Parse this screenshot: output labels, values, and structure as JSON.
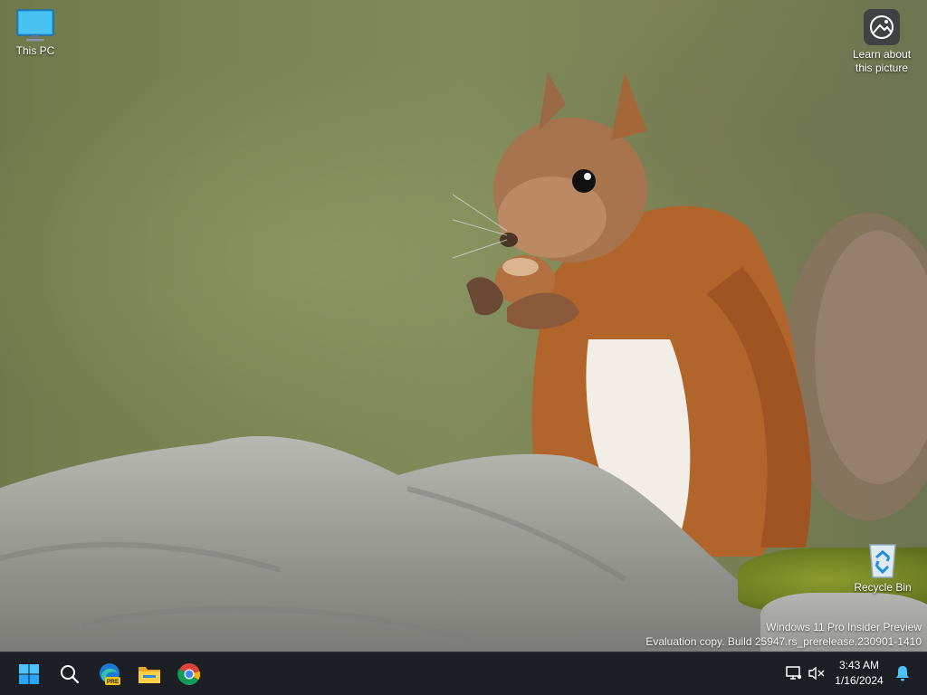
{
  "desktop": {
    "icons": [
      {
        "label": "This PC"
      },
      {
        "label": "Recycle Bin"
      }
    ],
    "spotlight": {
      "label_line1": "Learn about",
      "label_line2": "this picture"
    },
    "watermark": {
      "line1": "Windows 11 Pro Insider Preview",
      "line2": "Evaluation copy. Build 25947.rs_prerelease.230901-1410"
    }
  },
  "taskbar": {
    "apps": [
      {
        "name": "start",
        "icon": "windows-logo-icon"
      },
      {
        "name": "search",
        "icon": "search-icon"
      },
      {
        "name": "edge-preview",
        "icon": "edge-pre-icon",
        "badge": "PRE"
      },
      {
        "name": "file-explorer",
        "icon": "folder-icon"
      },
      {
        "name": "chrome",
        "icon": "chrome-icon"
      }
    ],
    "clock": {
      "time": "3:43 AM",
      "date": "1/16/2024"
    }
  },
  "colors": {
    "taskbar_bg": "#1c1f24",
    "accent": "#0078d4"
  }
}
